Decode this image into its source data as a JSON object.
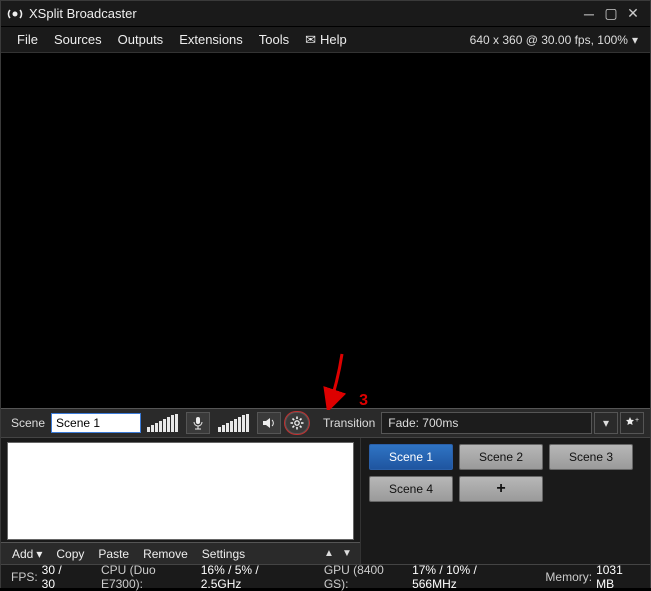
{
  "window": {
    "title": "XSplit Broadcaster"
  },
  "menubar": {
    "file": "File",
    "sources": "Sources",
    "outputs": "Outputs",
    "extensions": "Extensions",
    "tools": "Tools",
    "help": "Help",
    "stream_info": "640 x 360 @ 30.00 fps, 100%"
  },
  "scene_panel": {
    "label": "Scene",
    "current_name": "Scene 1"
  },
  "transition": {
    "label": "Transition",
    "value": "Fade: 700ms"
  },
  "sources_toolbar": {
    "add": "Add",
    "copy": "Copy",
    "paste": "Paste",
    "remove": "Remove",
    "settings": "Settings"
  },
  "scenes": {
    "items": [
      {
        "label": "Scene 1",
        "active": true
      },
      {
        "label": "Scene 2",
        "active": false
      },
      {
        "label": "Scene 3",
        "active": false
      },
      {
        "label": "Scene 4",
        "active": false
      }
    ],
    "add_label": "+"
  },
  "status": {
    "fps_label": "FPS:",
    "fps_value": "30 / 30",
    "cpu_label": "CPU (Duo E7300):",
    "cpu_value": "16% / 5% / 2.5GHz",
    "gpu_label": "GPU (8400 GS):",
    "gpu_value": "17% / 10% / 566MHz",
    "mem_label": "Memory:",
    "mem_value": "1031 MB"
  },
  "annotation": {
    "step": "3"
  }
}
